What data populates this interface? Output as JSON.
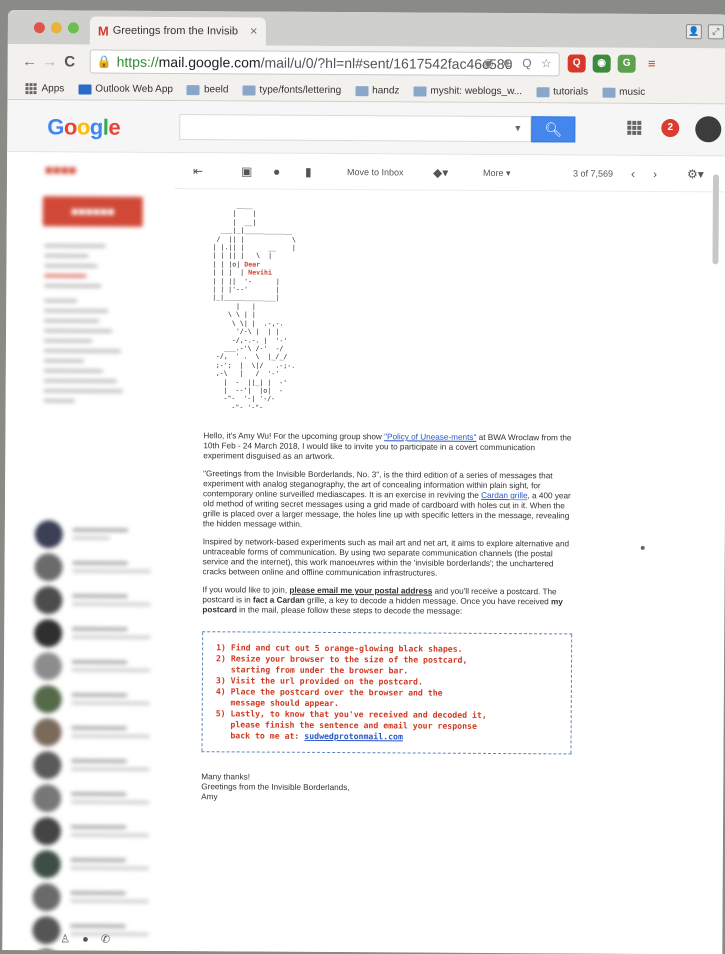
{
  "tab": {
    "title": "Greetings from the Invisib",
    "close": "✕"
  },
  "address_bar": {
    "url_scheme": "https://",
    "url_host": "mail.google.com",
    "url_path": "/mail/u/0/?hl=nl#sent/1617542fac46c580"
  },
  "bookmarks": [
    "Apps",
    "Outlook Web App",
    "beeld",
    "type/fonts/lettering",
    "handz",
    "myshit: weblogs_w...",
    "tutorials",
    "music"
  ],
  "gmail": {
    "logo": [
      "G",
      "o",
      "o",
      "g",
      "l",
      "e"
    ],
    "notif_count": "2",
    "toolbar": {
      "move_to_inbox": "Move to Inbox",
      "more": "More",
      "count": "3 of 7,569"
    }
  },
  "art": {
    "top": "      ____\n     |    |\n     |  __|\n  ___|_|____________\n /  || |            \\\n| |.|| |      __    |\n| | || |   \\  |\n| | |o|",
    "dear": "Dear",
    "name": "Nevihi",
    "bottom": "| | ||  '-      |\n| | |'--'       |\n|_|_____________|\n      |   |\n    \\ \\ | |\n     \\ \\| |  .-,-.\n      '/-\\ |  | |\n     -/,-.-. |  '-'\n   ___.-'\\ /-'  -/\n -/,  ' .  \\  |_/_/\n ;-';  |  \\|/   .-;-.\n ,-\\   |   /  '-'\n   |  -  ||_| |  -'\n   |  --'|  |o|  -\n   -\"-  '-| '-/-\n     -\"- '-\"-"
  },
  "body": {
    "p1_a": "Hello, it's Amy Wu! For the upcoming group show ",
    "p1_link": "\"Policy of Unease-ments\"",
    "p1_b": " at BWA Wroclaw from the 10th Feb - 24 March 2018, I would like to invite you to participate in a covert communication experiment disguised as an artwork.",
    "p2_a": "\"Greetings from the Invisible Borderlands, No. 3\", is the third edition of a series of messages that experiment with analog steganography, the art of concealing information within plain sight, for contemporary online surveilled mediascapes. It is an exercise in reviving the ",
    "p2_link": "Cardan grille",
    "p2_b": ", a 400 year old method of writing secret messages using a grid made of cardboard with holes cut in it. When the grille is placed over a larger message, the holes line up with specific letters in the message, revealing the hidden message within.",
    "p3": "Inspired by network-based experiments such as mail art and net art, it aims to explore alternative and untraceable forms of communication. By using two separate communication channels (the postal service and the internet), this work manoeuvres within the 'invisible borderlands'; the unchartered cracks between online and offline communication infrastructures.",
    "p4_a": "If you would like to join, ",
    "p4_b": "please email me your postal address",
    "p4_c": " and you'll receive a postcard. The postcard is in ",
    "p4_d": "fact a Cardan",
    "p4_e": " grille, a key to decode a hidden message. Once you have received ",
    "p4_f": "my postcard",
    "p4_g": " in the mail, please follow these steps to decode the message:"
  },
  "steps": {
    "s1": "1) Find and cut out 5 orange-glowing black shapes.",
    "s2": "2) Resize your browser to the size of the postcard,\n   starting from under the browser bar.",
    "s3": "3) Visit the url provided on the postcard.",
    "s4": "4) Place the postcard over the browser and the\n   message should appear.",
    "s5": "5) Lastly, to know that you've received and decoded it,\n   please finish the sentence and email your response\n   back to me at: ",
    "email": "sudwedprotonmail.com"
  },
  "signoff": {
    "l1": "Many thanks!",
    "l2": "Greetings from the Invisible Borderlands,",
    "l3": "Amy"
  },
  "colors": {
    "gmail_red": "#d14836",
    "search_blue": "#4486ec",
    "step_red": "#cf3a22",
    "link_blue": "#2a56c6"
  }
}
